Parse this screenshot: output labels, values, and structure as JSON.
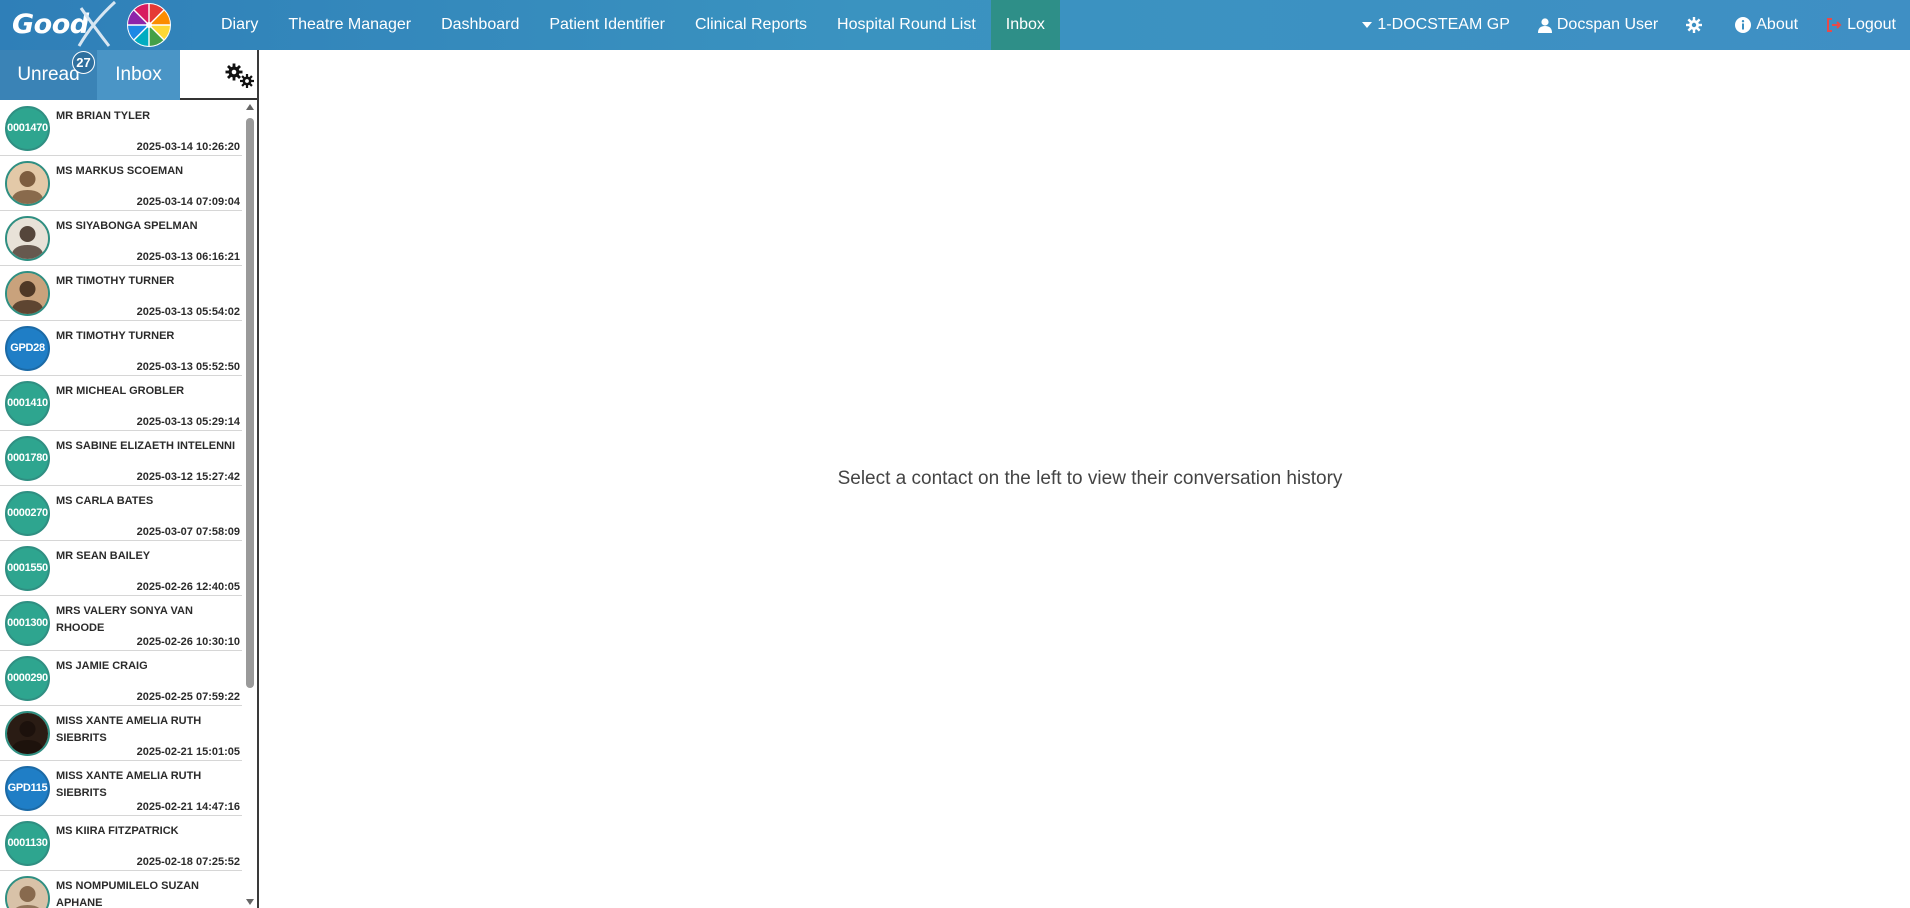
{
  "header": {
    "logo_text": "Good",
    "nav": [
      {
        "label": "Diary",
        "active": false
      },
      {
        "label": "Theatre Manager",
        "active": false
      },
      {
        "label": "Dashboard",
        "active": false
      },
      {
        "label": "Patient Identifier",
        "active": false
      },
      {
        "label": "Clinical Reports",
        "active": false
      },
      {
        "label": "Hospital Round List",
        "active": false
      },
      {
        "label": "Inbox",
        "active": true
      }
    ],
    "practice": "1-DOCSTEAM GP",
    "user": "Docspan User",
    "about": "About",
    "logout": "Logout",
    "brand_color": "#3a8fc2",
    "active_color": "#2e8f88"
  },
  "sidebar": {
    "tabs": {
      "unread": "Unread",
      "inbox": "Inbox",
      "unread_count": "27"
    },
    "contacts": [
      {
        "avatar": "0001470",
        "avatar_type": "green",
        "name": "MR BRIAN TYLER",
        "time": "2025-03-14 10:26:20"
      },
      {
        "avatar": "",
        "avatar_type": "photo",
        "name": "MS MARKUS SCOEMAN",
        "time": "2025-03-14 07:09:04"
      },
      {
        "avatar": "",
        "avatar_type": "photo",
        "name": "MS SIYABONGA SPELMAN",
        "time": "2025-03-13 06:16:21"
      },
      {
        "avatar": "",
        "avatar_type": "photo",
        "name": "MR TIMOTHY TURNER",
        "time": "2025-03-13 05:54:02"
      },
      {
        "avatar": "GPD28",
        "avatar_type": "blue",
        "name": "MR TIMOTHY TURNER",
        "time": "2025-03-13 05:52:50"
      },
      {
        "avatar": "0001410",
        "avatar_type": "green",
        "name": "MR MICHEAL GROBLER",
        "time": "2025-03-13 05:29:14"
      },
      {
        "avatar": "0001780",
        "avatar_type": "green",
        "name": "MS SABINE ELIZAETH INTELENNI",
        "time": "2025-03-12 15:27:42"
      },
      {
        "avatar": "0000270",
        "avatar_type": "green",
        "name": "MS CARLA BATES",
        "time": "2025-03-07 07:58:09"
      },
      {
        "avatar": "0001550",
        "avatar_type": "green",
        "name": "MR SEAN BAILEY",
        "time": "2025-02-26 12:40:05"
      },
      {
        "avatar": "0001300",
        "avatar_type": "green",
        "name": "MRS VALERY SONYA VAN RHOODE",
        "time": "2025-02-26 10:30:10"
      },
      {
        "avatar": "0000290",
        "avatar_type": "green",
        "name": "MS JAMIE CRAIG",
        "time": "2025-02-25 07:59:22"
      },
      {
        "avatar": "",
        "avatar_type": "photo",
        "name": "MISS XANTE AMELIA RUTH SIEBRITS",
        "time": "2025-02-21 15:01:05"
      },
      {
        "avatar": "GPD115",
        "avatar_type": "blue",
        "name": "MISS XANTE AMELIA RUTH SIEBRITS",
        "time": "2025-02-21 14:47:16"
      },
      {
        "avatar": "0001130",
        "avatar_type": "green",
        "name": "MS KIIRA FITZPATRICK",
        "time": "2025-02-18 07:25:52"
      },
      {
        "avatar": "",
        "avatar_type": "photo",
        "name": "MS NOMPUMILELO SUZAN APHANE",
        "time": ""
      }
    ]
  },
  "main": {
    "empty_message": "Select a contact on the left to view their conversation history"
  }
}
